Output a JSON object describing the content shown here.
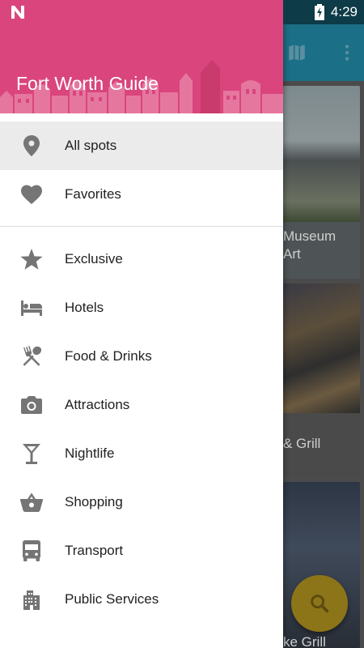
{
  "status_bar": {
    "time": "4:29"
  },
  "drawer": {
    "title": "Fort Worth Guide",
    "primary_items": [
      {
        "label": "All spots",
        "icon": "location-pin-icon",
        "selected": true
      },
      {
        "label": "Favorites",
        "icon": "heart-icon",
        "selected": false
      }
    ],
    "category_items": [
      {
        "label": "Exclusive",
        "icon": "star-icon"
      },
      {
        "label": "Hotels",
        "icon": "bed-icon"
      },
      {
        "label": "Food & Drinks",
        "icon": "fork-spoon-icon"
      },
      {
        "label": "Attractions",
        "icon": "camera-icon"
      },
      {
        "label": "Nightlife",
        "icon": "cocktail-icon"
      },
      {
        "label": "Shopping",
        "icon": "basket-icon"
      },
      {
        "label": "Transport",
        "icon": "bus-icon"
      },
      {
        "label": "Public Services",
        "icon": "buildings-icon"
      }
    ]
  },
  "background_list": {
    "cards": [
      {
        "caption_line1": "Museum",
        "caption_line2": "Art"
      },
      {
        "caption_line1": "& Grill"
      },
      {
        "caption_line1": "ke Grill"
      }
    ]
  },
  "colors": {
    "header_pink": "#d9457c",
    "toolbar_teal": "#1b6f86",
    "icon_gray": "#757575",
    "fab_amber": "#8c7418"
  }
}
